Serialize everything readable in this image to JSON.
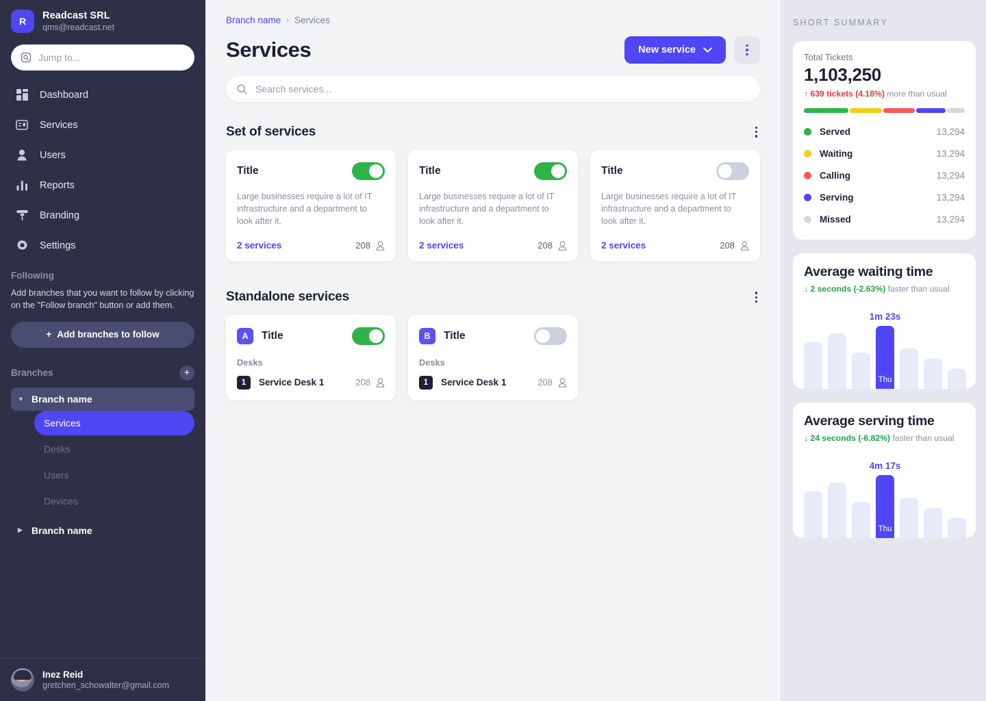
{
  "sidebar": {
    "org": {
      "initial": "R",
      "name": "Readcast SRL",
      "email": "qms@readcast.net"
    },
    "jump_placeholder": "Jump to...",
    "nav": [
      {
        "label": "Dashboard",
        "icon": "dashboard-icon"
      },
      {
        "label": "Services",
        "icon": "services-icon"
      },
      {
        "label": "Users",
        "icon": "users-icon"
      },
      {
        "label": "Reports",
        "icon": "reports-icon"
      },
      {
        "label": "Branding",
        "icon": "branding-icon"
      },
      {
        "label": "Settings",
        "icon": "settings-icon"
      }
    ],
    "following": {
      "label": "Following",
      "description": "Add branches that you want to follow by clicking on the \"Follow branch\" button or add them.",
      "button": "Add branches to follow"
    },
    "branches": {
      "label": "Branches",
      "add": "+",
      "first": {
        "name": "Branch name",
        "caret": "▼"
      },
      "sub_items": [
        "Services",
        "Desks",
        "Users",
        "Devices"
      ],
      "active_sub": "Services",
      "second": {
        "name": "Branch name",
        "caret": "▶"
      }
    },
    "user": {
      "name": "Inez Reid",
      "email": "gretchen_schowalter@gmail.com"
    }
  },
  "main": {
    "breadcrumb": {
      "root": "Branch name",
      "separator": "›",
      "current": "Services"
    },
    "title": "Services",
    "new_button": "New service",
    "search_placeholder": "Search services...",
    "sections": [
      {
        "title": "Set of services",
        "cards": [
          {
            "title": "Title",
            "toggle": "on",
            "desc": "Large businesses require a lot of IT infrastructure and a department to look after it.",
            "link": "2 services",
            "count": "208"
          },
          {
            "title": "Title",
            "toggle": "on",
            "desc": "Large businesses require a lot of IT infrastructure and a department to look after it.",
            "link": "2 services",
            "count": "208"
          },
          {
            "title": "Title",
            "toggle": "off",
            "desc": "Large businesses require a lot of IT infrastructure and a department to look after it.",
            "link": "2 services",
            "count": "208"
          }
        ]
      },
      {
        "title": "Standalone services",
        "cards": [
          {
            "badge": "A",
            "title": "Title",
            "toggle": "on",
            "desks_label": "Desks",
            "desk_num": "1",
            "desk_name": "Service Desk 1",
            "count": "208"
          },
          {
            "badge": "B",
            "title": "Title",
            "toggle": "off",
            "desks_label": "Desks",
            "desk_num": "1",
            "desk_name": "Service Desk 1",
            "count": "208"
          }
        ]
      }
    ]
  },
  "right": {
    "heading": "SHORT SUMMARY",
    "total": {
      "label": "Total Tickets",
      "value": "1,103,250",
      "delta_arrow": "↑",
      "delta_strong": "639 tickets (4.18%)",
      "delta_rest": "more than usual"
    },
    "breakdown": [
      {
        "name": "Served",
        "value": "13,294",
        "color": "#2eb34a",
        "share": 30
      },
      {
        "name": "Waiting",
        "value": "13,294",
        "color": "#f5cc17",
        "share": 22
      },
      {
        "name": "Calling",
        "value": "13,294",
        "color": "#f95a5a",
        "share": 21
      },
      {
        "name": "Serving",
        "value": "13,294",
        "color": "#4f46f5",
        "share": 20
      },
      {
        "name": "Missed",
        "value": "13,294",
        "color": "#d6d8e0",
        "share": 12
      }
    ]
  },
  "chart_data": [
    {
      "type": "bar",
      "title": "Average waiting time",
      "subtitle_arrow": "↓",
      "subtitle_strong": "2 seconds (-2.63%)",
      "subtitle_rest": "faster than usual",
      "categories": [
        "",
        "",
        "",
        "Thu",
        "",
        "",
        ""
      ],
      "values": [
        74,
        88,
        58,
        100,
        64,
        48,
        31
      ],
      "highlight_index": 3,
      "highlight_label": "1m 23s",
      "xlabel": "",
      "ylabel": "",
      "grid": false,
      "legend": "none"
    },
    {
      "type": "bar",
      "title": "Average serving time",
      "subtitle_arrow": "↓",
      "subtitle_strong": "24 seconds (-6.82%)",
      "subtitle_rest": "faster than usual",
      "categories": [
        "",
        "",
        "",
        "Thu",
        "",
        "",
        ""
      ],
      "values": [
        74,
        88,
        58,
        100,
        64,
        48,
        31
      ],
      "highlight_index": 3,
      "highlight_label": "4m 17s",
      "xlabel": "",
      "ylabel": "",
      "grid": false,
      "legend": "none"
    }
  ]
}
